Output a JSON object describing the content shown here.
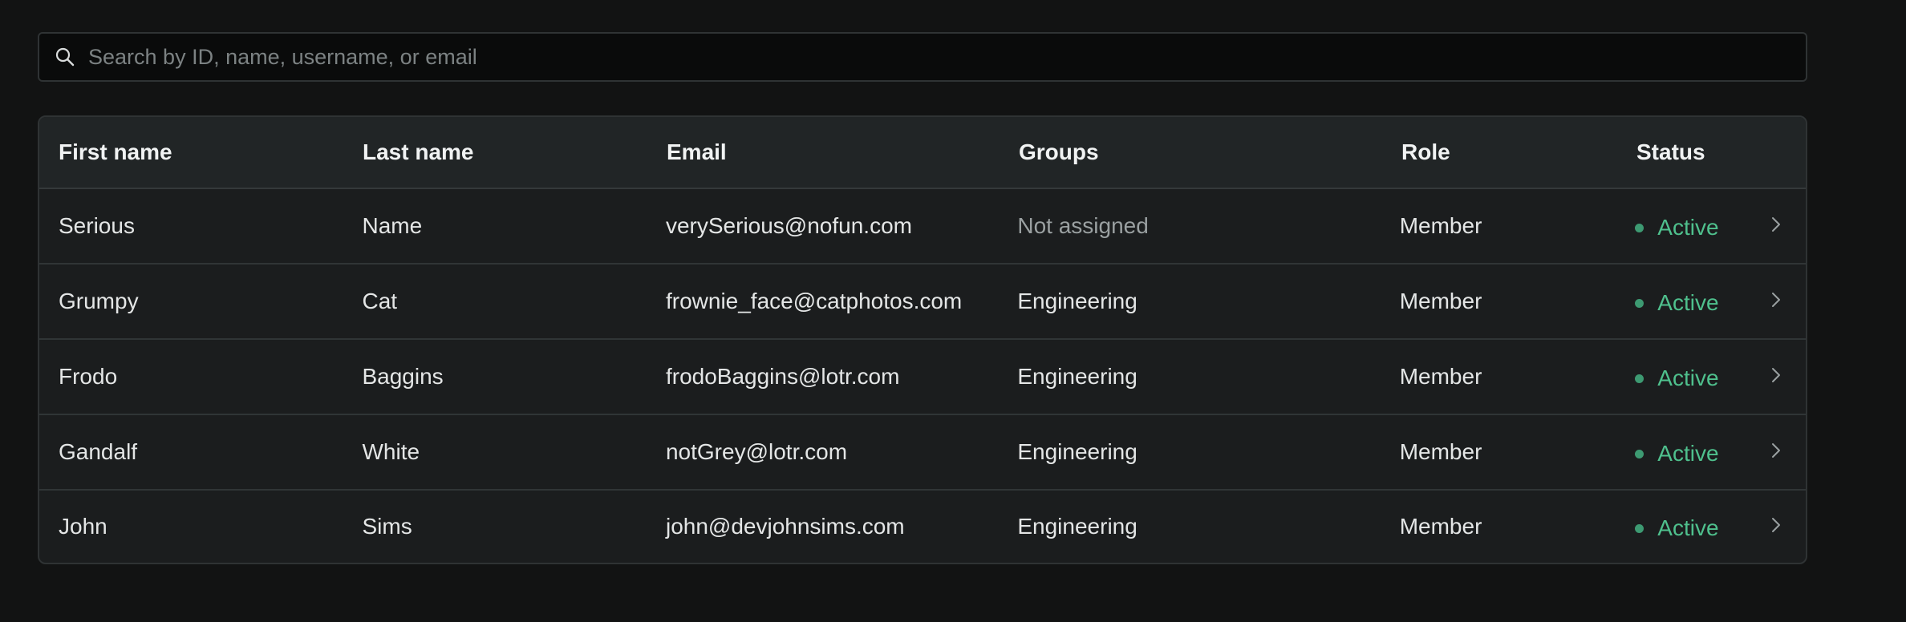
{
  "search": {
    "placeholder": "Search by ID, name, username, or email",
    "value": "",
    "icon": "search-icon"
  },
  "table": {
    "columns": [
      "First name",
      "Last name",
      "Email",
      "Groups",
      "Role",
      "Status"
    ],
    "rows": [
      {
        "first_name": "Serious",
        "last_name": "Name",
        "email": "verySerious@nofun.com",
        "groups": "Not assigned",
        "groups_muted": true,
        "role": "Member",
        "status": "Active"
      },
      {
        "first_name": "Grumpy",
        "last_name": "Cat",
        "email": "frownie_face@catphotos.com",
        "groups": "Engineering",
        "groups_muted": false,
        "role": "Member",
        "status": "Active"
      },
      {
        "first_name": "Frodo",
        "last_name": "Baggins",
        "email": "frodoBaggins@lotr.com",
        "groups": "Engineering",
        "groups_muted": false,
        "role": "Member",
        "status": "Active"
      },
      {
        "first_name": "Gandalf",
        "last_name": "White",
        "email": "notGrey@lotr.com",
        "groups": "Engineering",
        "groups_muted": false,
        "role": "Member",
        "status": "Active"
      },
      {
        "first_name": "John",
        "last_name": "Sims",
        "email": "john@devjohnsims.com",
        "groups": "Engineering",
        "groups_muted": false,
        "role": "Member",
        "status": "Active"
      }
    ]
  },
  "colors": {
    "background": "#121313",
    "status_active": "#4fc08d",
    "border": "#2f3334"
  }
}
